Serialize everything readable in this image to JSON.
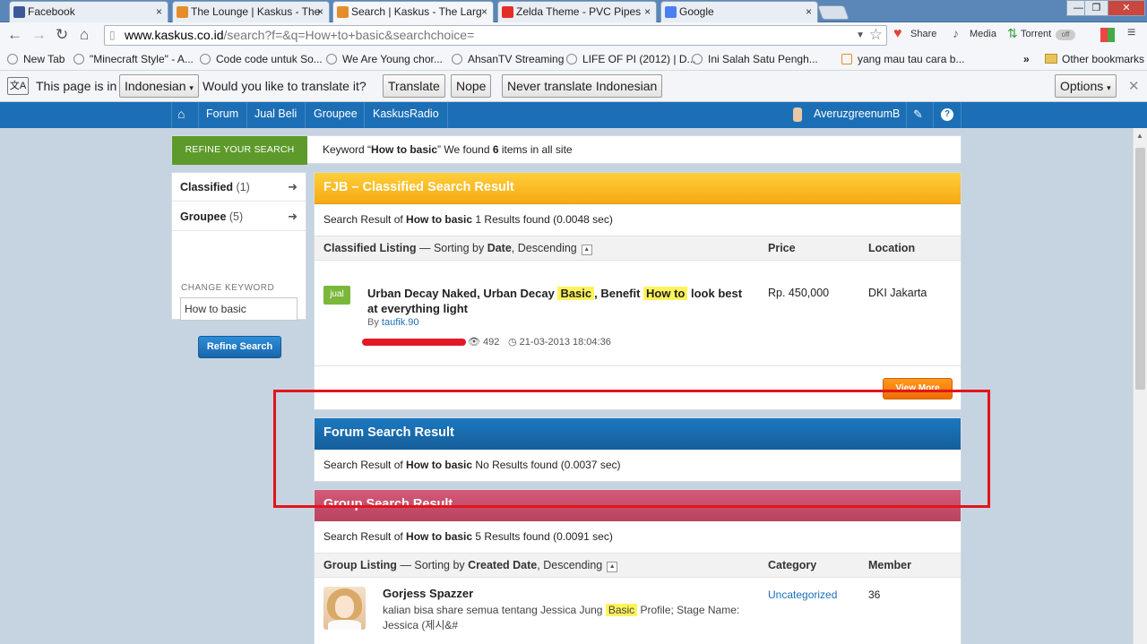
{
  "browser": {
    "tabs": [
      {
        "title": "Facebook",
        "favicon_color": "#3b5998"
      },
      {
        "title": "The Lounge | Kaskus - The",
        "favicon_color": "#e58d2b"
      },
      {
        "title": "Search | Kaskus - The Larg",
        "favicon_color": "#e58d2b"
      },
      {
        "title": "Zelda Theme - PVC Pipes",
        "favicon_color": "#e52d27"
      },
      {
        "title": "Google",
        "favicon_color": "#4a7ff0"
      }
    ],
    "tab_close": "×",
    "window_buttons": [
      "—",
      "❐",
      "✕"
    ],
    "url_domain": "www.kaskus.co.id",
    "url_rest": "/search?f=&q=How+to+basic&searchchoice=",
    "extensions": {
      "share": "Share",
      "media": "Media",
      "torrent": "Torrent",
      "toggle": "off"
    },
    "bookmarks": [
      "New Tab",
      "\"Minecraft Style\" - A...",
      "Code code untuk So...",
      "We Are Young chor...",
      "AhsanTV Streaming",
      "LIFE OF PI (2012) | D...",
      "Ini Salah Satu Pengh...",
      "yang mau tau cara b..."
    ],
    "bookmarks_overflow": "»",
    "other_bookmarks": "Other bookmarks",
    "translate": {
      "prefix": "This page is in",
      "language": "Indonesian",
      "question": "Would you like to translate it?",
      "translate_btn": "Translate",
      "nope_btn": "Nope",
      "never_btn": "Never translate Indonesian",
      "options_btn": "Options"
    }
  },
  "site_nav": {
    "items": [
      "Forum",
      "Jual Beli",
      "Groupee",
      "KaskusRadio"
    ],
    "username": "AveruzgreenumB"
  },
  "keyword_bar": {
    "refine_tab": "REFINE YOUR SEARCH",
    "keyword_prefix": "Keyword “",
    "keyword": "How to basic",
    "keyword_mid": "” We found ",
    "count": "6",
    "keyword_suffix": " items in all site"
  },
  "sidebar": {
    "classified_label": "Classified",
    "classified_count": "(1)",
    "groupee_label": "Groupee",
    "groupee_count": "(5)",
    "change_keyword": "CHANGE KEYWORD",
    "keyword_value": "How to basic",
    "refine_btn": "Refine Search"
  },
  "fjb": {
    "title": "FJB – Classified Search Result",
    "result_prefix": "Search Result of ",
    "keyword": "How to basic",
    "result_suffix": " 1 Results found (0.0048 sec)",
    "listing_label": "Classified Listing",
    "sorting_prefix": " — Sorting by ",
    "sort_field": "Date",
    "sort_dir": ", Descending",
    "col_price": "Price",
    "col_location": "Location",
    "item": {
      "badge": "jual",
      "title_a": "Urban Decay Naked, Urban Decay ",
      "hl1": "Basic",
      "title_b": ", Benefit ",
      "hl2": "How to",
      "title_c": " look best at everything light",
      "by_prefix": "By ",
      "author": "taufik.90",
      "views": "492",
      "date": "21-03-2013 18:04:36",
      "price": "Rp. 450,000",
      "location": "DKI Jakarta"
    },
    "view_more": "View More"
  },
  "forum": {
    "title": "Forum Search Result",
    "result_prefix": "Search Result of ",
    "keyword": "How to basic",
    "result_suffix": " No Results found (0.0037 sec)"
  },
  "group": {
    "title": "Group Search Result",
    "result_prefix": "Search Result of ",
    "keyword": "How to basic",
    "result_suffix": " 5 Results found (0.0091 sec)",
    "listing_label": "Group Listing",
    "sorting_prefix": " — Sorting by ",
    "sort_field": "Created Date",
    "sort_dir": ", Descending",
    "col_category": "Category",
    "col_member": "Member",
    "item": {
      "title": "Gorjess Spazzer",
      "desc_a": "kalian bisa share semua tentang Jessica Jung ",
      "hl": "Basic",
      "desc_b": " Profile; Stage Name: Jessica (제시&#",
      "category": "Uncategorized",
      "members": "36"
    }
  },
  "colors": {
    "nav_blue": "#1c6fb5",
    "refine_green": "#5d9a2b",
    "fjb_orange": "#f6a912",
    "forum_blue": "#165e9a",
    "group_pink": "#b8435f",
    "highlight_yellow": "#fff35c",
    "annotation_red": "#e3141d"
  }
}
